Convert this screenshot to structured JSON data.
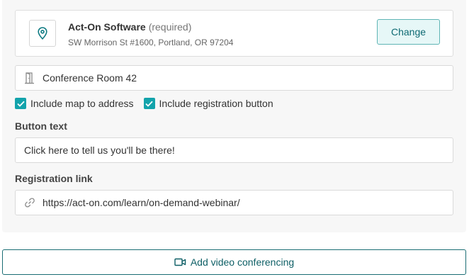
{
  "location": {
    "name": "Act-On Software",
    "required": "(required)",
    "address": "SW Morrison St #1600, Portland, OR 97204",
    "change_label": "Change"
  },
  "room": {
    "value": "Conference Room 42",
    "icon": "door-icon"
  },
  "options": {
    "include_map_label": "Include map to address",
    "include_map_checked": true,
    "include_registration_label": "Include registration button",
    "include_registration_checked": true
  },
  "button_text": {
    "label": "Button text",
    "value": "Click here to tell us you'll be there!"
  },
  "registration_link": {
    "label": "Registration link",
    "value": "https://act-on.com/learn/on-demand-webinar/",
    "icon": "link-icon"
  },
  "video": {
    "label": "Add video conferencing",
    "icon": "video-camera-icon"
  },
  "colors": {
    "accent": "#13a3ab",
    "accent_dark": "#0e5f66",
    "panel_bg": "#f7f7f7"
  }
}
